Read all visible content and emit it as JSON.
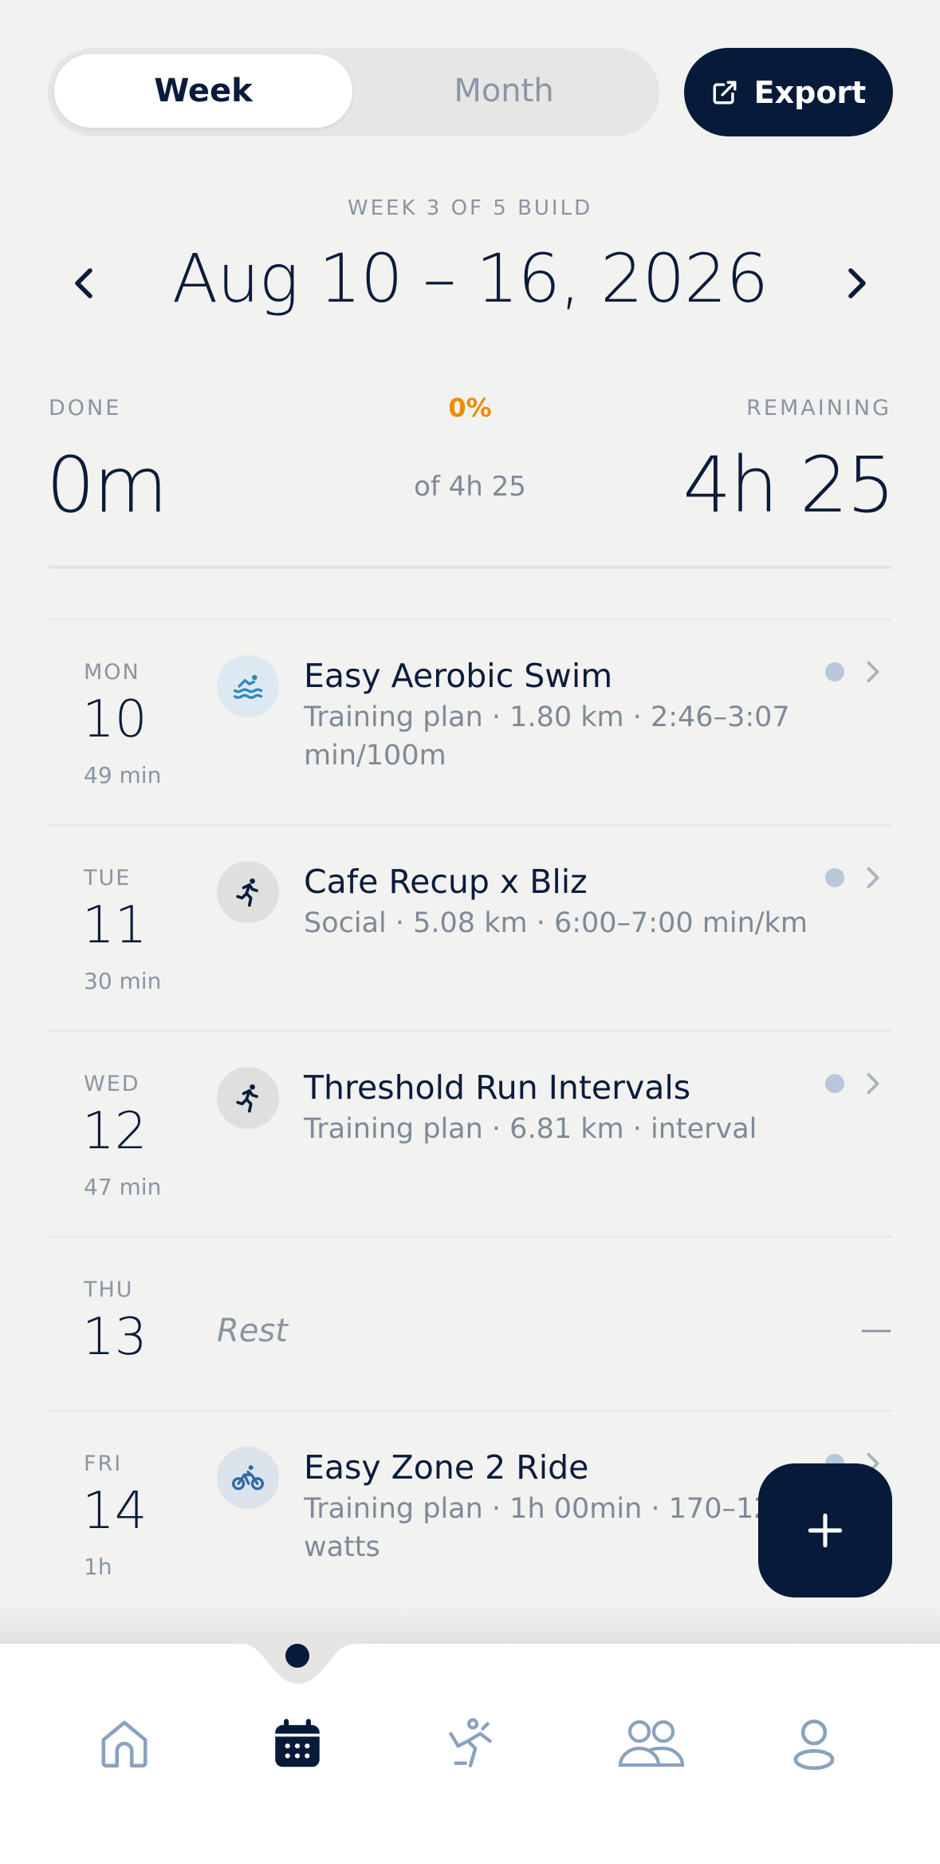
{
  "toggle": {
    "week_label": "Week",
    "month_label": "Month",
    "selected": "Week"
  },
  "export": {
    "label": "Export",
    "icon": "external-link-icon"
  },
  "week": {
    "label": "WEEK 3 OF 5  BUILD",
    "range": "Aug 10 – 16, 2026",
    "prev_icon": "chevron-left-icon",
    "next_icon": "chevron-right-icon"
  },
  "summary": {
    "done_label": "DONE",
    "done_value": "0m",
    "percent": "0%",
    "progress_fraction": 0,
    "of_total": "of 4h 25",
    "remaining_label": "REMAINING",
    "remaining_value": "4h 25"
  },
  "days": [
    {
      "abbr": "MON",
      "num": "10",
      "duration": "49 min",
      "type": "swim",
      "title": "Easy Aerobic Swim",
      "subtitle": "Training plan · 1.80 km · 2:46–3:07 min/100m"
    },
    {
      "abbr": "TUE",
      "num": "11",
      "duration": "30 min",
      "type": "run",
      "title": "Cafe Recup x Bliz",
      "subtitle": "Social · 5.08 km · 6:00–7:00 min/km"
    },
    {
      "abbr": "WED",
      "num": "12",
      "duration": "47 min",
      "type": "run",
      "title": "Threshold Run Intervals",
      "subtitle": "Training plan · 6.81 km · interval"
    },
    {
      "abbr": "THU",
      "num": "13",
      "rest_label": "Rest",
      "rest_dash": "—"
    },
    {
      "abbr": "FRI",
      "num": "14",
      "duration": "1h",
      "type": "ride",
      "title": "Easy Zone 2 Ride",
      "subtitle": "Training plan · 1h 00min · 170–127 watts"
    }
  ],
  "fab": {
    "icon": "plus-icon"
  },
  "nav": {
    "items": [
      "home-icon",
      "calendar-icon",
      "workout-icon",
      "community-icon",
      "profile-icon"
    ],
    "active": "calendar-icon"
  },
  "colors": {
    "background": "#f2f2f0",
    "navy": "#071a3a",
    "accent_orange": "#f08a00",
    "muted": "#8a95a3",
    "status_dot": "#b8c8da"
  }
}
